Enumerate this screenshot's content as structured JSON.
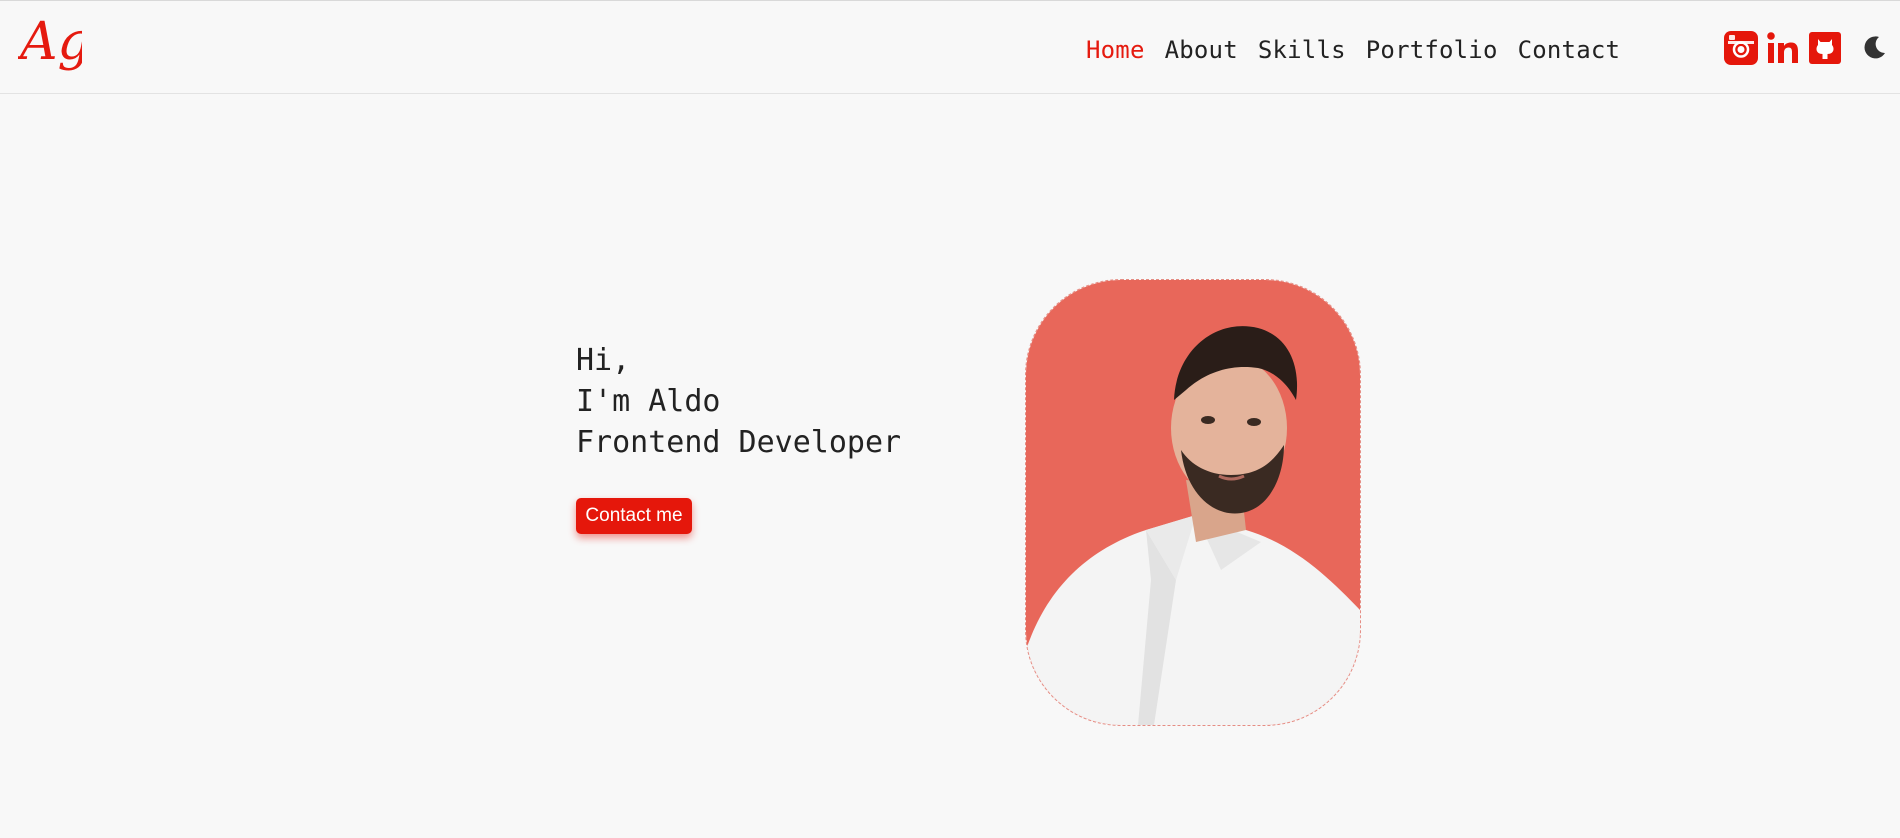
{
  "header": {
    "logo_text": "Ag",
    "nav": [
      {
        "label": "Home",
        "active": true
      },
      {
        "label": "About",
        "active": false
      },
      {
        "label": "Skills",
        "active": false
      },
      {
        "label": "Portfolio",
        "active": false
      },
      {
        "label": "Contact",
        "active": false
      }
    ],
    "social_icons": [
      "instagram-icon",
      "linkedin-icon",
      "github-icon"
    ],
    "theme_toggle_icon": "moon-icon"
  },
  "hero": {
    "greeting": "Hi,",
    "name_line": "I'm Aldo",
    "role_line": "Frontend Developer",
    "cta_label": "Contact me",
    "portrait_subject": "profile-photo"
  },
  "colors": {
    "accent": "#e5170b",
    "portrait_bg": "#e8675a",
    "background": "#f8f8f8",
    "text": "#222222"
  }
}
